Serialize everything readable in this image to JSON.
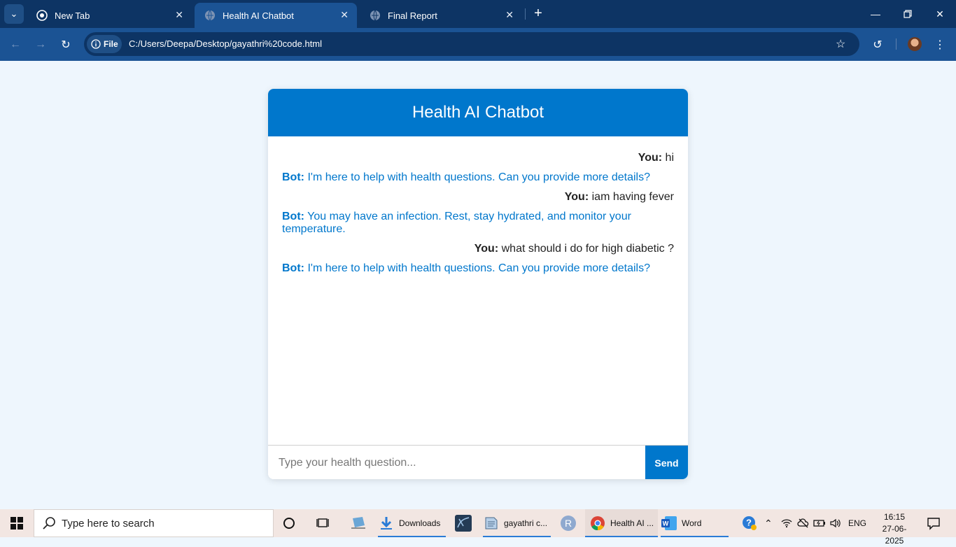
{
  "browser": {
    "tabs": [
      {
        "title": "New Tab",
        "active": false
      },
      {
        "title": "Health AI Chatbot",
        "active": true
      },
      {
        "title": "Final Report",
        "active": false
      }
    ],
    "file_chip": "File",
    "url": "C:/Users/Deepa/Desktop/gayathri%20code.html"
  },
  "chat": {
    "title": "Health AI Chatbot",
    "messages": [
      {
        "sender": "user",
        "label": "You:",
        "text": "hi"
      },
      {
        "sender": "bot",
        "label": "Bot:",
        "text": "I'm here to help with health questions. Can you provide more details?"
      },
      {
        "sender": "user",
        "label": "You:",
        "text": "iam having fever"
      },
      {
        "sender": "bot",
        "label": "Bot:",
        "text": "You may have an infection. Rest, stay hydrated, and monitor your temperature."
      },
      {
        "sender": "user",
        "label": "You:",
        "text": "what should i do for high diabetic ?"
      },
      {
        "sender": "bot",
        "label": "Bot:",
        "text": "I'm here to help with health questions. Can you provide more details?"
      }
    ],
    "input_placeholder": "Type your health question...",
    "input_value": "",
    "send_label": "Send"
  },
  "taskbar": {
    "search_placeholder": "Type here to search",
    "apps": [
      {
        "label": "Downloads"
      },
      {
        "label": "gayathri c..."
      },
      {
        "label": "Health AI ..."
      },
      {
        "label": "Word"
      }
    ],
    "language": "ENG",
    "time": "16:15",
    "date": "27-06-2025"
  },
  "colors": {
    "chrome_dark": "#0d3464",
    "chrome_toolbar": "#1b5394",
    "accent": "#0077cc",
    "page_bg": "#eef6fd"
  }
}
